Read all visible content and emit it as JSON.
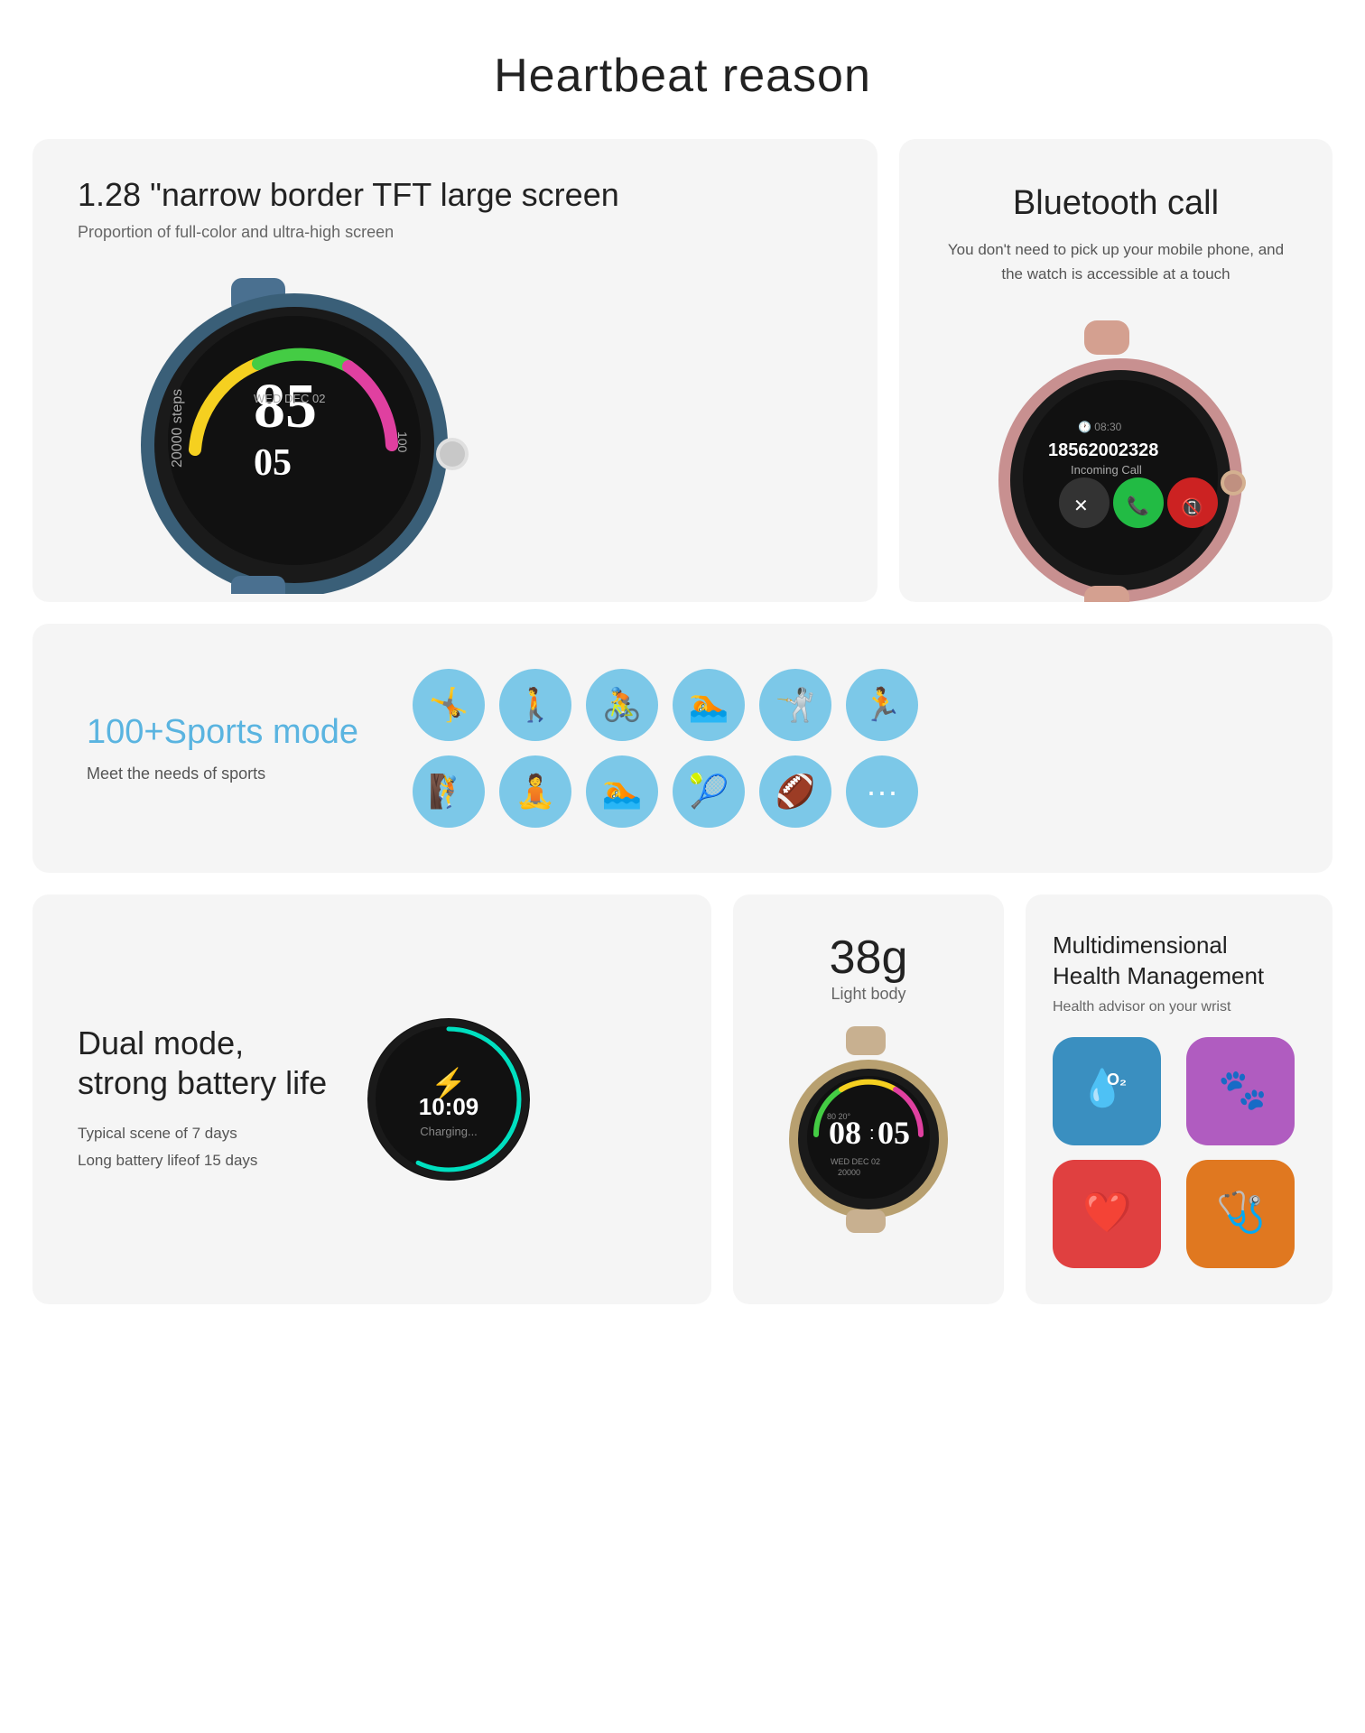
{
  "page": {
    "title": "Heartbeat reason"
  },
  "card_left": {
    "heading": "1.28 \"narrow border TFT large screen",
    "sub": "Proportion of full-color and ultra-high screen"
  },
  "card_right": {
    "heading": "Bluetooth call",
    "body": "You don't need to pick up your mobile phone, and the watch is accessible at a touch"
  },
  "sports": {
    "heading": "100+Sports mode",
    "body": "Meet the needs of sports",
    "icons": [
      "🤸",
      "🚶",
      "🚴",
      "🏊",
      "🤺",
      "🏃",
      "🧗",
      "🧘",
      "🏊",
      "🎾",
      "🏈",
      "···"
    ]
  },
  "battery": {
    "heading": "Dual mode,\nstrong battery life",
    "line1": "Typical scene of 7 days",
    "line2": "Long battery lifeof 15 days",
    "time": "10:09",
    "charging_label": "Charging..."
  },
  "weight": {
    "value": "38g",
    "label": "Light body"
  },
  "health": {
    "heading": "Multidimensional\nHealth Management",
    "sub": "Health advisor on your wrist"
  }
}
